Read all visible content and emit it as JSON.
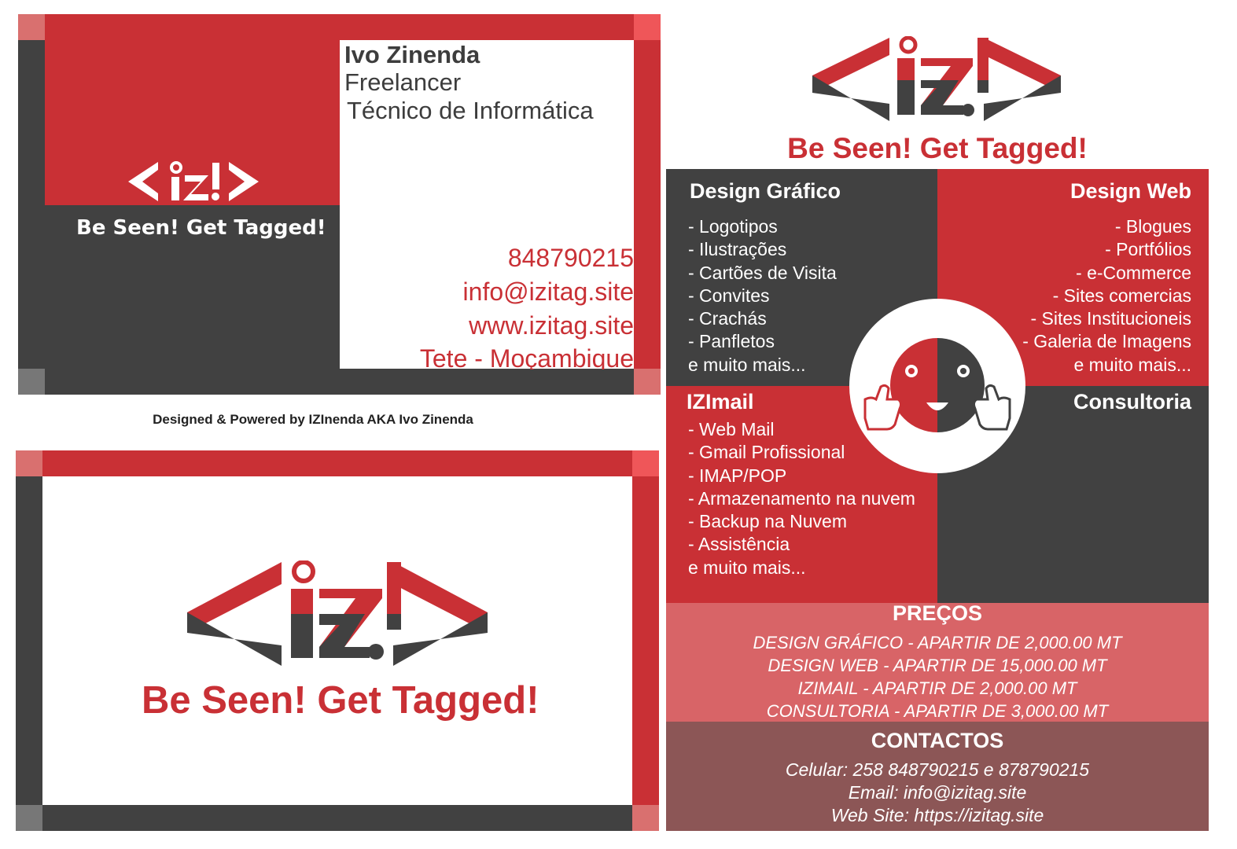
{
  "card_front": {
    "name": "Ivo Zinenda",
    "role": "Freelancer",
    "title": "Técnico de Informática",
    "logo_text": "IZ!",
    "tagline": "Be Seen! Get Tagged!",
    "phone": "848790215",
    "email": "info@izitag.site",
    "website": "www.izitag.site",
    "location": "Tete - Moçambique"
  },
  "credit": "Designed & Powered by IZInenda AKA Ivo Zinenda",
  "card_back": {
    "logo_text": "IZ!",
    "tagline_part1": "Be Seen!",
    "tagline_part2": "Get Tagged!"
  },
  "flyer": {
    "tagline_part1": "Be Seen!",
    "tagline_part2": "Get Tagged!",
    "design_grafico": {
      "title": "Design Gráfico",
      "items": [
        "- Logotipos",
        "- Ilustrações",
        "- Cartões de Visita",
        "- Convites",
        "- Crachás",
        "- Panfletos",
        "e muito mais..."
      ]
    },
    "design_web": {
      "title": "Design Web",
      "items": [
        "- Blogues",
        "- Portfólios",
        "- e-Commerce",
        "- Sites comercias",
        "- Sites Institucioneis",
        "- Galeria de Imagens",
        "e muito mais..."
      ]
    },
    "izimail": {
      "title": "IZImail",
      "items": [
        "- Web Mail",
        "- Gmail Profissional",
        "- IMAP/POP",
        "- Armazenamento na nuvem",
        "- Backup na Nuvem",
        "- Assistência",
        "e muito mais..."
      ]
    },
    "consultoria": {
      "title": "Consultoria"
    },
    "precos": {
      "title": "PREÇOS",
      "lines": [
        "DESIGN GRÁFICO - APARTIR DE 2,000.00 MT",
        "DESIGN WEB - APARTIR DE 15,000.00 MT",
        "IZIMAIL - APARTIR DE 2,000.00 MT",
        "CONSULTORIA - APARTIR DE 3,000.00 MT"
      ]
    },
    "contactos": {
      "title": "CONTACTOS",
      "lines": [
        "Celular: 258 848790215 e 878790215",
        "Email: info@izitag.site",
        "Web Site: https://izitag.site"
      ]
    }
  },
  "colors": {
    "red": "#c93035",
    "dark": "#414141",
    "pink": "#d86467",
    "maroon": "#8c5656"
  }
}
